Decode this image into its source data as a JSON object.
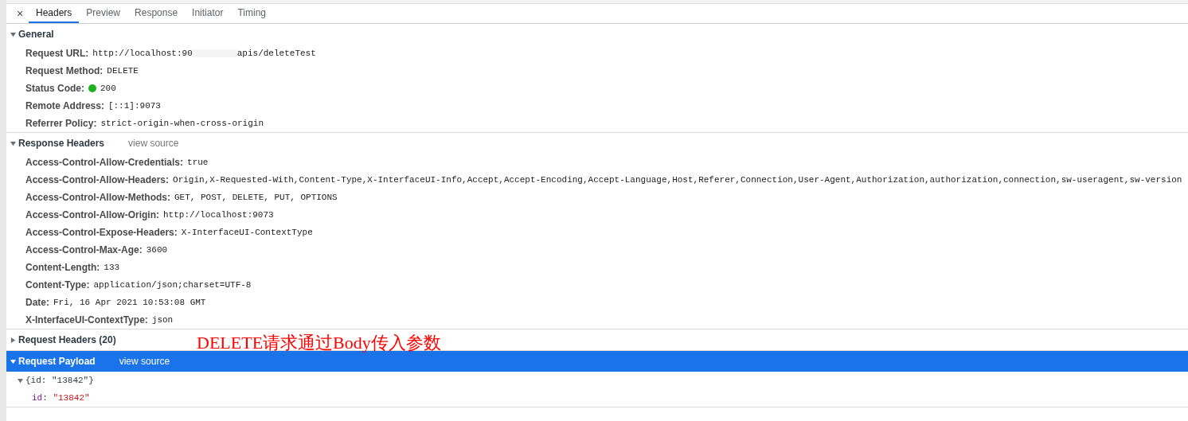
{
  "tabs": [
    {
      "label": "Headers",
      "selected": true
    },
    {
      "label": "Preview",
      "selected": false
    },
    {
      "label": "Response",
      "selected": false
    },
    {
      "label": "Initiator",
      "selected": false
    },
    {
      "label": "Timing",
      "selected": false
    }
  ],
  "close_label": "×",
  "sections": [
    {
      "title": "General",
      "expanded": true,
      "selected": false,
      "rows": [
        {
          "name": "Request URL:",
          "value": "http://localhost:90",
          "value_after_redaction": "apis/deleteTest",
          "redacted": true
        },
        {
          "name": "Request Method:",
          "value": "DELETE"
        },
        {
          "name": "Status Code:",
          "value": "200",
          "color": "#1db21d"
        },
        {
          "name": "Remote Address:",
          "value": "[::1]:9073"
        },
        {
          "name": "Referrer Policy:",
          "value": "strict-origin-when-cross-origin"
        }
      ]
    },
    {
      "title": "Response Headers",
      "link": "view source",
      "expanded": true,
      "selected": false,
      "rows": [
        {
          "name": "Access-Control-Allow-Credentials:",
          "value": "true"
        },
        {
          "name": "Access-Control-Allow-Headers:",
          "value": "Origin,X-Requested-With,Content-Type,X-InterfaceUI-Info,Accept,Accept-Encoding,Accept-Language,Host,Referer,Connection,User-Agent,Authorization,authorization,connection,sw-useragent,sw-version"
        },
        {
          "name": "Access-Control-Allow-Methods:",
          "value": "GET, POST, DELETE, PUT, OPTIONS"
        },
        {
          "name": "Access-Control-Allow-Origin:",
          "value": "http://localhost:9073"
        },
        {
          "name": "Access-Control-Expose-Headers:",
          "value": "X-InterfaceUI-ContextType"
        },
        {
          "name": "Access-Control-Max-Age:",
          "value": "3600"
        },
        {
          "name": "Content-Length:",
          "value": "133"
        },
        {
          "name": "Content-Type:",
          "value": "application/json;charset=UTF-8"
        },
        {
          "name": "Date:",
          "value": "Fri, 16 Apr 2021 10:53:08 GMT"
        },
        {
          "name": "X-InterfaceUI-ContextType:",
          "value": "json"
        }
      ]
    },
    {
      "title": "Request Headers (20)",
      "expanded": false,
      "selected": false
    },
    {
      "title": "Request Payload",
      "link": "view source",
      "expanded": true,
      "selected": true,
      "payload": {
        "summary": "{id: \"13842\"}",
        "expanded": true,
        "props": [
          {
            "key": "id",
            "separator": ":",
            "value": "\"13842\""
          }
        ]
      }
    }
  ],
  "annotation": "DELETE请求通过Body传入参数"
}
